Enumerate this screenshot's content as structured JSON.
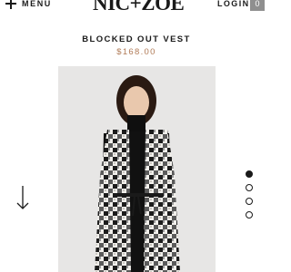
{
  "header": {
    "menu_label": "MENU",
    "logo_text": "NIC+ZOE",
    "login_label": "LOGIN",
    "cart_count": "0"
  },
  "product": {
    "title": "BLOCKED OUT VEST",
    "price": "$168.00"
  },
  "gallery": {
    "slide_count": 4,
    "active_index": 0
  },
  "colors": {
    "price": "#b07a56",
    "photo_background": "#e7e6e5",
    "cart_badge": "#8f8f8f"
  },
  "icons": [
    "plus-icon",
    "down-arrow-icon"
  ]
}
